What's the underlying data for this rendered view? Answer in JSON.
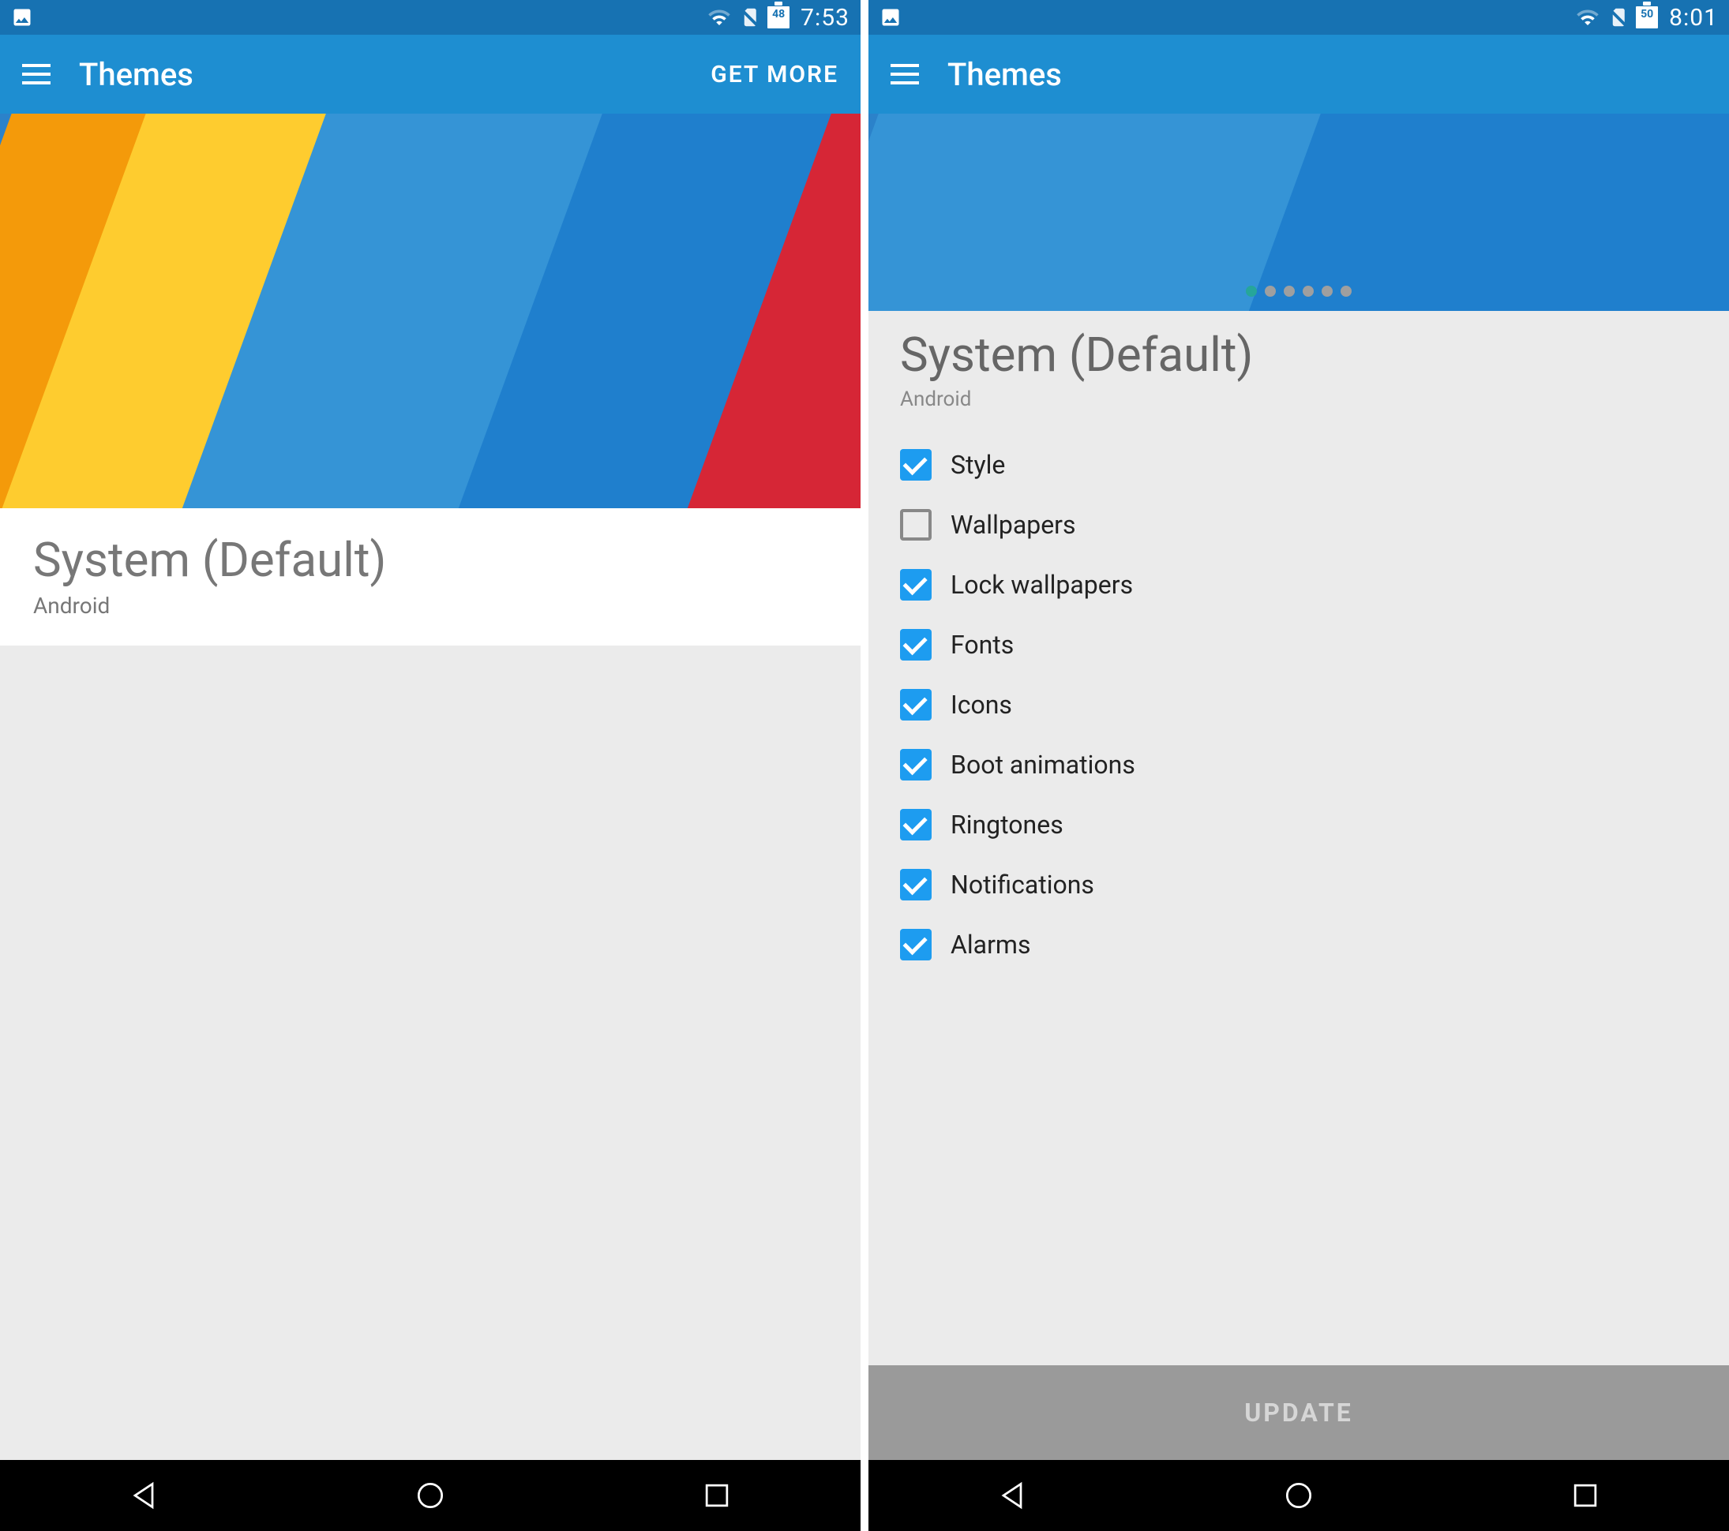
{
  "status": {
    "left": {
      "time": "7:53",
      "battery": "48"
    },
    "right": {
      "time": "8:01",
      "battery": "50"
    }
  },
  "appbar": {
    "title": "Themes",
    "get_more": "GET MORE"
  },
  "theme": {
    "title": "System (Default)",
    "author": "Android"
  },
  "options": [
    {
      "label": "Style",
      "checked": true
    },
    {
      "label": "Wallpapers",
      "checked": false
    },
    {
      "label": "Lock wallpapers",
      "checked": true
    },
    {
      "label": "Fonts",
      "checked": true
    },
    {
      "label": "Icons",
      "checked": true
    },
    {
      "label": "Boot animations",
      "checked": true
    },
    {
      "label": "Ringtones",
      "checked": true
    },
    {
      "label": "Notifications",
      "checked": true
    },
    {
      "label": "Alarms",
      "checked": true
    }
  ],
  "update": "UPDATE",
  "pager": {
    "count": 6,
    "active": 0
  }
}
